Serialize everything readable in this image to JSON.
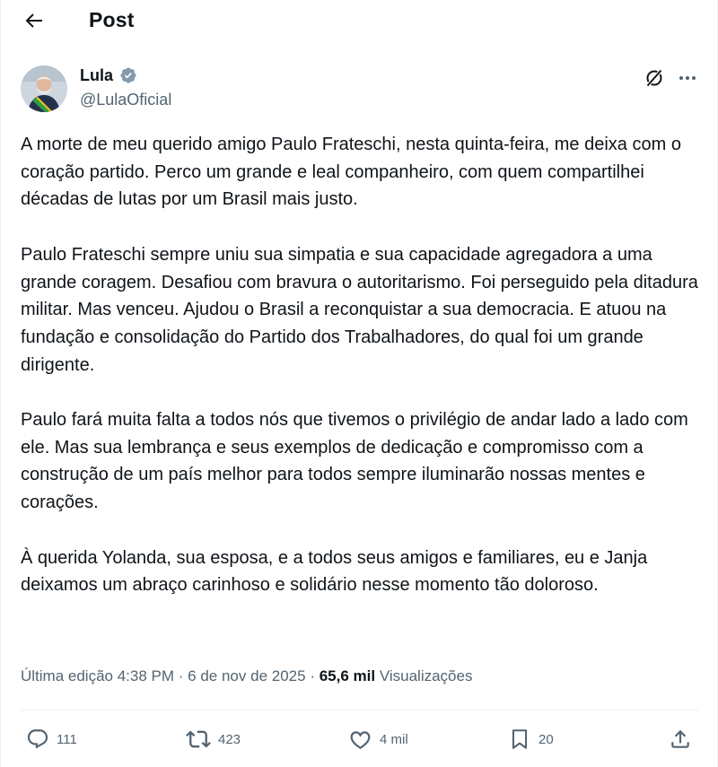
{
  "header": {
    "title": "Post"
  },
  "author": {
    "name": "Lula",
    "handle": "@LulaOficial"
  },
  "post": {
    "paragraphs": [
      "A morte de meu querido amigo Paulo Frateschi, nesta quinta-feira, me deixa com o coração partido. Perco um grande e leal companheiro, com quem compartilhei décadas de lutas por um Brasil mais justo.",
      "Paulo Frateschi sempre uniu sua simpatia e sua capacidade agregadora a uma grande coragem. Desafiou com bravura o autoritarismo. Foi perseguido pela ditadura militar. Mas venceu. Ajudou o Brasil a reconquistar a sua democracia. E atuou na fundação e consolidação do Partido dos Trabalhadores, do qual foi um grande dirigente.",
      "Paulo fará muita falta a todos nós que tivemos o privilégio de andar lado a lado com ele. Mas sua lembrança e seus exemplos de dedicação e compromisso com a construção de um país melhor para todos sempre iluminarão nossas mentes e corações.",
      "À querida Yolanda, sua esposa, e a todos seus amigos e familiares, eu e Janja deixamos um abraço carinhoso e solidário nesse momento tão doloroso."
    ]
  },
  "meta": {
    "edited": "Última edição 4:38 PM",
    "date": "6 de nov de 2025",
    "sep": "·",
    "views_count": "65,6 mil",
    "views_label": "Visualizações"
  },
  "actions": {
    "replies": "111",
    "reposts": "423",
    "likes": "4 mil",
    "bookmarks": "20"
  },
  "icons": [
    "back-arrow-icon",
    "verified-badge-icon",
    "grok-icon",
    "more-icon",
    "reply-icon",
    "repost-icon",
    "like-icon",
    "bookmark-icon",
    "share-icon"
  ],
  "colors": {
    "verified": "#829aab",
    "secondary_text": "#536471",
    "primary_text": "#0f1419"
  }
}
